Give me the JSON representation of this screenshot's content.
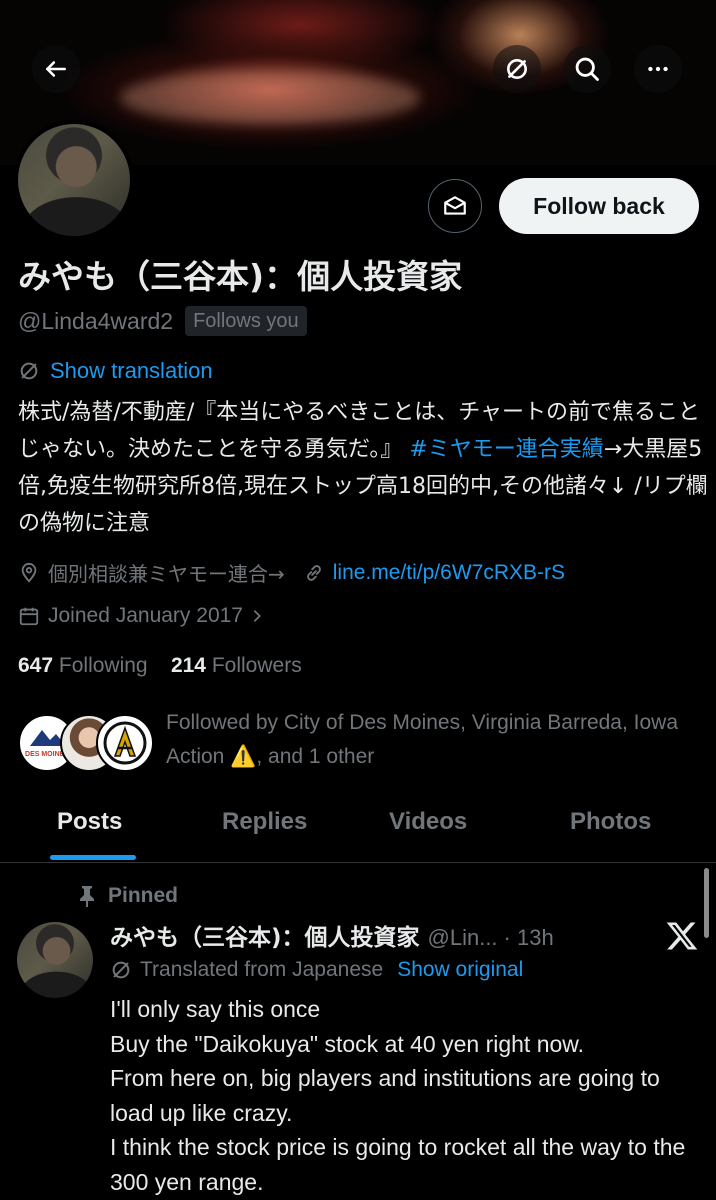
{
  "header": {
    "back_icon": "arrow-left-icon",
    "grok_icon": "grok-slash-icon",
    "search_icon": "search-icon",
    "more_icon": "more-horizontal-icon"
  },
  "profile": {
    "display_name": "みやも（三谷本)：個人投資家",
    "handle": "@Linda4ward2",
    "follows_you": "Follows you",
    "message_icon": "mail-icon",
    "follow_button": "Follow back",
    "show_translation": "Show translation",
    "bio": {
      "text_before_tag": "株式/為替/不動産/『本当にやるべきことは、チャートの前で焦ることじゃない。決めたことを守る勇気だ。』",
      "hashtag": "#ミヤモー連合実績",
      "text_after_tag": "→大黒屋5倍,免疫生物研究所8倍,現在ストップ高18回的中,その他諸々↓ /リプ欄の偽物に注意"
    },
    "location": "個別相談兼ミヤモー連合→",
    "website": "line.me/ti/p/6W7cRXB-rS",
    "joined": "Joined January 2017",
    "following_count": "647",
    "following_label": "Following",
    "followers_count": "214",
    "followers_label": "Followers",
    "followed_by": {
      "prefix": "Followed by City of Des Moines, Virginia Barreda, Iowa Action ",
      "emoji": "⚠️",
      "suffix": ", and 1 other",
      "avatar1_label": "DES MOINES"
    }
  },
  "tabs": [
    {
      "label": "Posts",
      "active": true
    },
    {
      "label": "Replies",
      "active": false
    },
    {
      "label": "Videos",
      "active": false
    },
    {
      "label": "Photos",
      "active": false
    }
  ],
  "post": {
    "pinned_label": "Pinned",
    "author_name": "みやも（三谷本)：個人投資家",
    "author_handle": "@Lin...",
    "timestamp": "· 13h",
    "translated_label": "Translated from Japanese",
    "show_original": "Show original",
    "text": "I'll only say this once\nBuy the \"Daikokuya\" stock at 40 yen right now.\nFrom here on, big players and institutions are going to load up like crazy.\nI think the stock price is going to rocket all the way to the 300 yen range."
  },
  "colors": {
    "background": "#000000",
    "text_primary": "#e7e9ea",
    "text_secondary": "#71767b",
    "link": "#1d9bf0",
    "follow_button_bg": "#eff3f4"
  }
}
